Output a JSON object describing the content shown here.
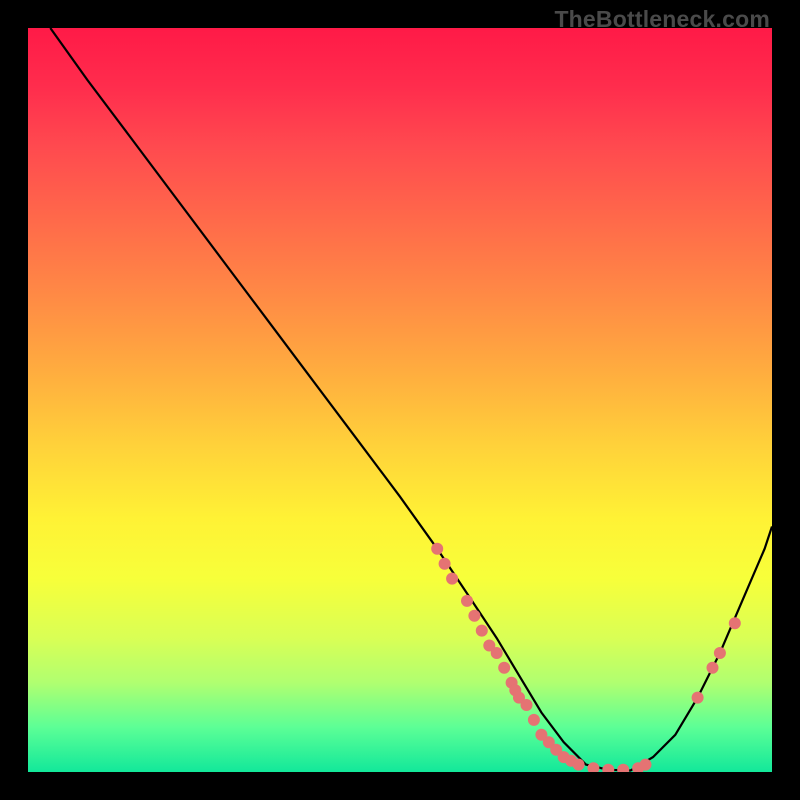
{
  "watermark": "TheBottleneck.com",
  "colors": {
    "gradient_top": "#ff1a47",
    "gradient_bottom": "#12e89a",
    "curve": "#000000",
    "points": "#e57373",
    "page_bg": "#000000"
  },
  "chart_data": {
    "type": "line",
    "title": "",
    "xlabel": "",
    "ylabel": "",
    "xlim": [
      0,
      100
    ],
    "ylim": [
      0,
      100
    ],
    "grid": false,
    "legend": false,
    "series": [
      {
        "name": "curve",
        "color": "#000000",
        "x": [
          3,
          8,
          14,
          20,
          26,
          32,
          38,
          44,
          50,
          55,
          59,
          63,
          66,
          69,
          72,
          75,
          78,
          81,
          84,
          87,
          90,
          93,
          96,
          99,
          100
        ],
        "y": [
          100,
          93,
          85,
          77,
          69,
          61,
          53,
          45,
          37,
          30,
          24,
          18,
          13,
          8,
          4,
          1,
          0.3,
          0.2,
          2,
          5,
          10,
          16,
          23,
          30,
          33
        ]
      }
    ],
    "points": [
      {
        "x": 55,
        "y": 30
      },
      {
        "x": 56,
        "y": 28
      },
      {
        "x": 57,
        "y": 26
      },
      {
        "x": 59,
        "y": 23
      },
      {
        "x": 60,
        "y": 21
      },
      {
        "x": 61,
        "y": 19
      },
      {
        "x": 62,
        "y": 17
      },
      {
        "x": 63,
        "y": 16
      },
      {
        "x": 64,
        "y": 14
      },
      {
        "x": 65,
        "y": 12
      },
      {
        "x": 65.5,
        "y": 11
      },
      {
        "x": 66,
        "y": 10
      },
      {
        "x": 67,
        "y": 9
      },
      {
        "x": 68,
        "y": 7
      },
      {
        "x": 69,
        "y": 5
      },
      {
        "x": 70,
        "y": 4
      },
      {
        "x": 71,
        "y": 3
      },
      {
        "x": 72,
        "y": 2
      },
      {
        "x": 73,
        "y": 1.5
      },
      {
        "x": 74,
        "y": 1
      },
      {
        "x": 76,
        "y": 0.5
      },
      {
        "x": 78,
        "y": 0.3
      },
      {
        "x": 80,
        "y": 0.3
      },
      {
        "x": 82,
        "y": 0.5
      },
      {
        "x": 83,
        "y": 1
      },
      {
        "x": 90,
        "y": 10
      },
      {
        "x": 92,
        "y": 14
      },
      {
        "x": 93,
        "y": 16
      },
      {
        "x": 95,
        "y": 20
      }
    ],
    "point_radius": 6
  }
}
